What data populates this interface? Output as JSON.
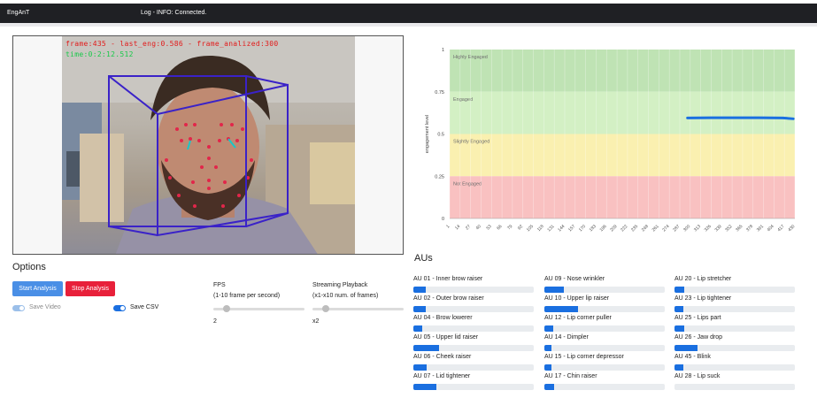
{
  "topbar": {
    "brand": "EngAnT",
    "status": "Log - INFO: Connected."
  },
  "video": {
    "overlay_line1": "frame:435 - last_eng:0.586 - frame_analized:300",
    "overlay_line2": "time:0:2:12.512"
  },
  "options": {
    "title": "Options",
    "start_label": "Start Analysis",
    "stop_label": "Stop Analysis",
    "save_video_label": "Save Video",
    "save_csv_label": "Save CSV",
    "save_video_on": true,
    "save_csv_on": true,
    "fps_title": "FPS",
    "fps_subtitle": "(1-10 frame per second)",
    "fps_value": "2",
    "playback_title": "Streaming Playback",
    "playback_subtitle": "(x1-x10 num. of frames)",
    "playback_value": "x2"
  },
  "chart_data": {
    "type": "line",
    "ylabel": "engagement level",
    "y_ticks": [
      "0",
      "0.25",
      "0.5",
      "0.75",
      "1"
    ],
    "ylim": [
      0,
      1
    ],
    "x_ticks": [
      "1",
      "14",
      "27",
      "40",
      "53",
      "66",
      "79",
      "92",
      "105",
      "118",
      "131",
      "144",
      "157",
      "170",
      "183",
      "196",
      "209",
      "222",
      "235",
      "248",
      "261",
      "274",
      "287",
      "300",
      "313",
      "326",
      "339",
      "352",
      "365",
      "378",
      "391",
      "404",
      "417",
      "430"
    ],
    "xlim": [
      1,
      435
    ],
    "bands": [
      {
        "label": "Highly Engaged",
        "from": 0.75,
        "to": 1.0,
        "color": "#bfe3b4"
      },
      {
        "label": "Engaged",
        "from": 0.5,
        "to": 0.75,
        "color": "#d3f0c4"
      },
      {
        "label": "Slightly Engaged",
        "from": 0.25,
        "to": 0.5,
        "color": "#faf0b0"
      },
      {
        "label": "Not Engaged",
        "from": 0.0,
        "to": 0.25,
        "color": "#f9c1c1"
      }
    ],
    "series": [
      {
        "color": "#1a6fe0",
        "x": [
          300,
          330,
          360,
          390,
          420,
          433
        ],
        "y": [
          0.595,
          0.596,
          0.596,
          0.596,
          0.595,
          0.59
        ]
      }
    ]
  },
  "aus": {
    "title": "AUs",
    "items": [
      {
        "label": "AU 01 - Inner brow raiser",
        "value": 0.1
      },
      {
        "label": "AU 02 - Outer brow raiser",
        "value": 0.1
      },
      {
        "label": "AU 04 - Brow lowerer",
        "value": 0.07
      },
      {
        "label": "AU 05 - Upper lid raiser",
        "value": 0.21
      },
      {
        "label": "AU 06 - Cheek raiser",
        "value": 0.11
      },
      {
        "label": "AU 07 - Lid tightener",
        "value": 0.19
      },
      {
        "label": "AU 09 - Nose wrinkler",
        "value": 0.16
      },
      {
        "label": "AU 10 - Upper lip raiser",
        "value": 0.28
      },
      {
        "label": "AU 12 - Lip corner puller",
        "value": 0.07
      },
      {
        "label": "AU 14 - Dimpler",
        "value": 0.06
      },
      {
        "label": "AU 15 - Lip corner depressor",
        "value": 0.06
      },
      {
        "label": "AU 17 - Chin raiser",
        "value": 0.08
      },
      {
        "label": "AU 20 - Lip stretcher",
        "value": 0.08
      },
      {
        "label": "AU 23 - Lip tightener",
        "value": 0.07
      },
      {
        "label": "AU 25 - Lips part",
        "value": 0.08
      },
      {
        "label": "AU 26 - Jaw drop",
        "value": 0.19
      },
      {
        "label": "AU 45 - Blink",
        "value": 0.07
      },
      {
        "label": "AU 28 - Lip suck",
        "value": 0.0
      }
    ]
  }
}
